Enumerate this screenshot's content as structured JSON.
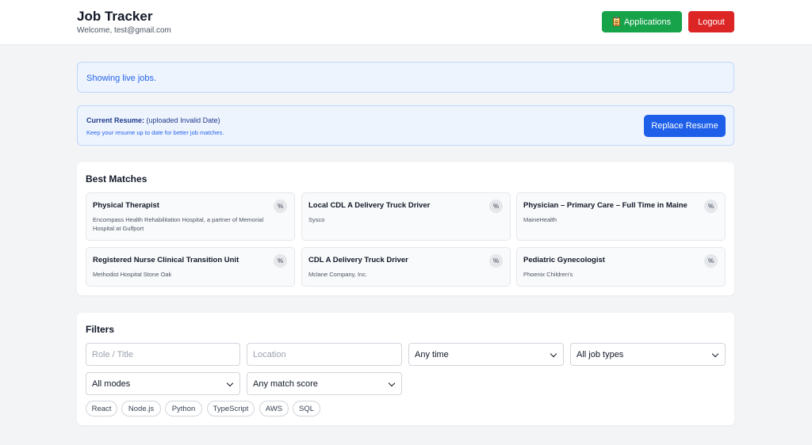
{
  "header": {
    "title": "Job Tracker",
    "welcome": "Welcome, test@gmail.com",
    "applications_label": "Applications",
    "logout_label": "Logout"
  },
  "live_banner": {
    "text": "Showing live jobs."
  },
  "resume": {
    "label": "Current Resume:",
    "status": "(uploaded Invalid Date)",
    "hint": "Keep your resume up to date for better job matches.",
    "replace_label": "Replace Resume"
  },
  "matches": {
    "title": "Best Matches",
    "items": [
      {
        "title": "Physical Therapist",
        "company": "Encompass Health Rehabilitation Hospital, a partner of Memorial Hospital at Gulfport",
        "score": "%"
      },
      {
        "title": "Local CDL A Delivery Truck Driver",
        "company": "Sysco",
        "score": "%"
      },
      {
        "title": "Physician – Primary Care – Full Time in Maine",
        "company": "MaineHealth",
        "score": "%"
      },
      {
        "title": "Registered Nurse Clinical Transition Unit",
        "company": "Methodist Hospital Stone Oak",
        "score": "%"
      },
      {
        "title": "CDL A Delivery Truck Driver",
        "company": "Mclane Company, Inc.",
        "score": "%"
      },
      {
        "title": "Pediatric Gynecologist",
        "company": "Phoenix Children's",
        "score": "%"
      }
    ]
  },
  "filters": {
    "title": "Filters",
    "role_placeholder": "Role / Title",
    "location_placeholder": "Location",
    "time_value": "Any time",
    "job_type_value": "All job types",
    "mode_value": "All modes",
    "score_value": "Any match score",
    "skills": [
      "React",
      "Node.js",
      "Python",
      "TypeScript",
      "AWS",
      "SQL"
    ]
  },
  "colors": {
    "applications_button": "#16a34a",
    "logout_button": "#dc2626",
    "primary": "#1d5fe8",
    "info_background": "#eef4fe"
  },
  "icons": {
    "applications": "clipboard-icon",
    "select_arrow": "chevron-down-icon"
  }
}
